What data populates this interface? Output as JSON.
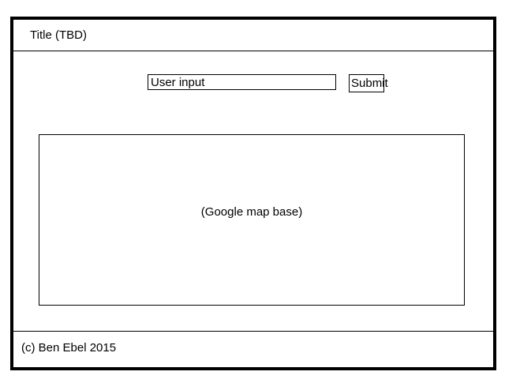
{
  "header": {
    "title": "Title (TBD)"
  },
  "search": {
    "placeholder": "User input",
    "value": "",
    "submit_label": "Submit"
  },
  "map": {
    "label": "(Google map base)"
  },
  "footer": {
    "copyright": "(c) Ben Ebel 2015"
  }
}
